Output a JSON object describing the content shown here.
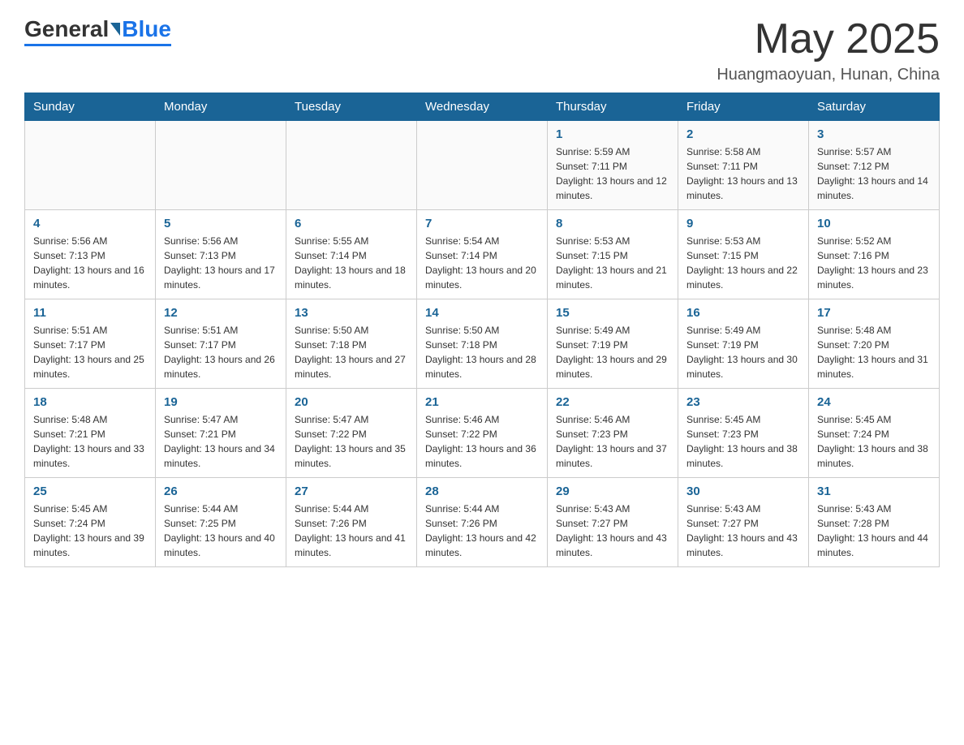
{
  "header": {
    "logo": {
      "general": "General",
      "blue": "Blue"
    },
    "month_title": "May 2025",
    "location": "Huangmaoyuan, Hunan, China"
  },
  "weekdays": [
    "Sunday",
    "Monday",
    "Tuesday",
    "Wednesday",
    "Thursday",
    "Friday",
    "Saturday"
  ],
  "weeks": [
    [
      {
        "day": "",
        "info": ""
      },
      {
        "day": "",
        "info": ""
      },
      {
        "day": "",
        "info": ""
      },
      {
        "day": "",
        "info": ""
      },
      {
        "day": "1",
        "info": "Sunrise: 5:59 AM\nSunset: 7:11 PM\nDaylight: 13 hours and 12 minutes."
      },
      {
        "day": "2",
        "info": "Sunrise: 5:58 AM\nSunset: 7:11 PM\nDaylight: 13 hours and 13 minutes."
      },
      {
        "day": "3",
        "info": "Sunrise: 5:57 AM\nSunset: 7:12 PM\nDaylight: 13 hours and 14 minutes."
      }
    ],
    [
      {
        "day": "4",
        "info": "Sunrise: 5:56 AM\nSunset: 7:13 PM\nDaylight: 13 hours and 16 minutes."
      },
      {
        "day": "5",
        "info": "Sunrise: 5:56 AM\nSunset: 7:13 PM\nDaylight: 13 hours and 17 minutes."
      },
      {
        "day": "6",
        "info": "Sunrise: 5:55 AM\nSunset: 7:14 PM\nDaylight: 13 hours and 18 minutes."
      },
      {
        "day": "7",
        "info": "Sunrise: 5:54 AM\nSunset: 7:14 PM\nDaylight: 13 hours and 20 minutes."
      },
      {
        "day": "8",
        "info": "Sunrise: 5:53 AM\nSunset: 7:15 PM\nDaylight: 13 hours and 21 minutes."
      },
      {
        "day": "9",
        "info": "Sunrise: 5:53 AM\nSunset: 7:15 PM\nDaylight: 13 hours and 22 minutes."
      },
      {
        "day": "10",
        "info": "Sunrise: 5:52 AM\nSunset: 7:16 PM\nDaylight: 13 hours and 23 minutes."
      }
    ],
    [
      {
        "day": "11",
        "info": "Sunrise: 5:51 AM\nSunset: 7:17 PM\nDaylight: 13 hours and 25 minutes."
      },
      {
        "day": "12",
        "info": "Sunrise: 5:51 AM\nSunset: 7:17 PM\nDaylight: 13 hours and 26 minutes."
      },
      {
        "day": "13",
        "info": "Sunrise: 5:50 AM\nSunset: 7:18 PM\nDaylight: 13 hours and 27 minutes."
      },
      {
        "day": "14",
        "info": "Sunrise: 5:50 AM\nSunset: 7:18 PM\nDaylight: 13 hours and 28 minutes."
      },
      {
        "day": "15",
        "info": "Sunrise: 5:49 AM\nSunset: 7:19 PM\nDaylight: 13 hours and 29 minutes."
      },
      {
        "day": "16",
        "info": "Sunrise: 5:49 AM\nSunset: 7:19 PM\nDaylight: 13 hours and 30 minutes."
      },
      {
        "day": "17",
        "info": "Sunrise: 5:48 AM\nSunset: 7:20 PM\nDaylight: 13 hours and 31 minutes."
      }
    ],
    [
      {
        "day": "18",
        "info": "Sunrise: 5:48 AM\nSunset: 7:21 PM\nDaylight: 13 hours and 33 minutes."
      },
      {
        "day": "19",
        "info": "Sunrise: 5:47 AM\nSunset: 7:21 PM\nDaylight: 13 hours and 34 minutes."
      },
      {
        "day": "20",
        "info": "Sunrise: 5:47 AM\nSunset: 7:22 PM\nDaylight: 13 hours and 35 minutes."
      },
      {
        "day": "21",
        "info": "Sunrise: 5:46 AM\nSunset: 7:22 PM\nDaylight: 13 hours and 36 minutes."
      },
      {
        "day": "22",
        "info": "Sunrise: 5:46 AM\nSunset: 7:23 PM\nDaylight: 13 hours and 37 minutes."
      },
      {
        "day": "23",
        "info": "Sunrise: 5:45 AM\nSunset: 7:23 PM\nDaylight: 13 hours and 38 minutes."
      },
      {
        "day": "24",
        "info": "Sunrise: 5:45 AM\nSunset: 7:24 PM\nDaylight: 13 hours and 38 minutes."
      }
    ],
    [
      {
        "day": "25",
        "info": "Sunrise: 5:45 AM\nSunset: 7:24 PM\nDaylight: 13 hours and 39 minutes."
      },
      {
        "day": "26",
        "info": "Sunrise: 5:44 AM\nSunset: 7:25 PM\nDaylight: 13 hours and 40 minutes."
      },
      {
        "day": "27",
        "info": "Sunrise: 5:44 AM\nSunset: 7:26 PM\nDaylight: 13 hours and 41 minutes."
      },
      {
        "day": "28",
        "info": "Sunrise: 5:44 AM\nSunset: 7:26 PM\nDaylight: 13 hours and 42 minutes."
      },
      {
        "day": "29",
        "info": "Sunrise: 5:43 AM\nSunset: 7:27 PM\nDaylight: 13 hours and 43 minutes."
      },
      {
        "day": "30",
        "info": "Sunrise: 5:43 AM\nSunset: 7:27 PM\nDaylight: 13 hours and 43 minutes."
      },
      {
        "day": "31",
        "info": "Sunrise: 5:43 AM\nSunset: 7:28 PM\nDaylight: 13 hours and 44 minutes."
      }
    ]
  ]
}
